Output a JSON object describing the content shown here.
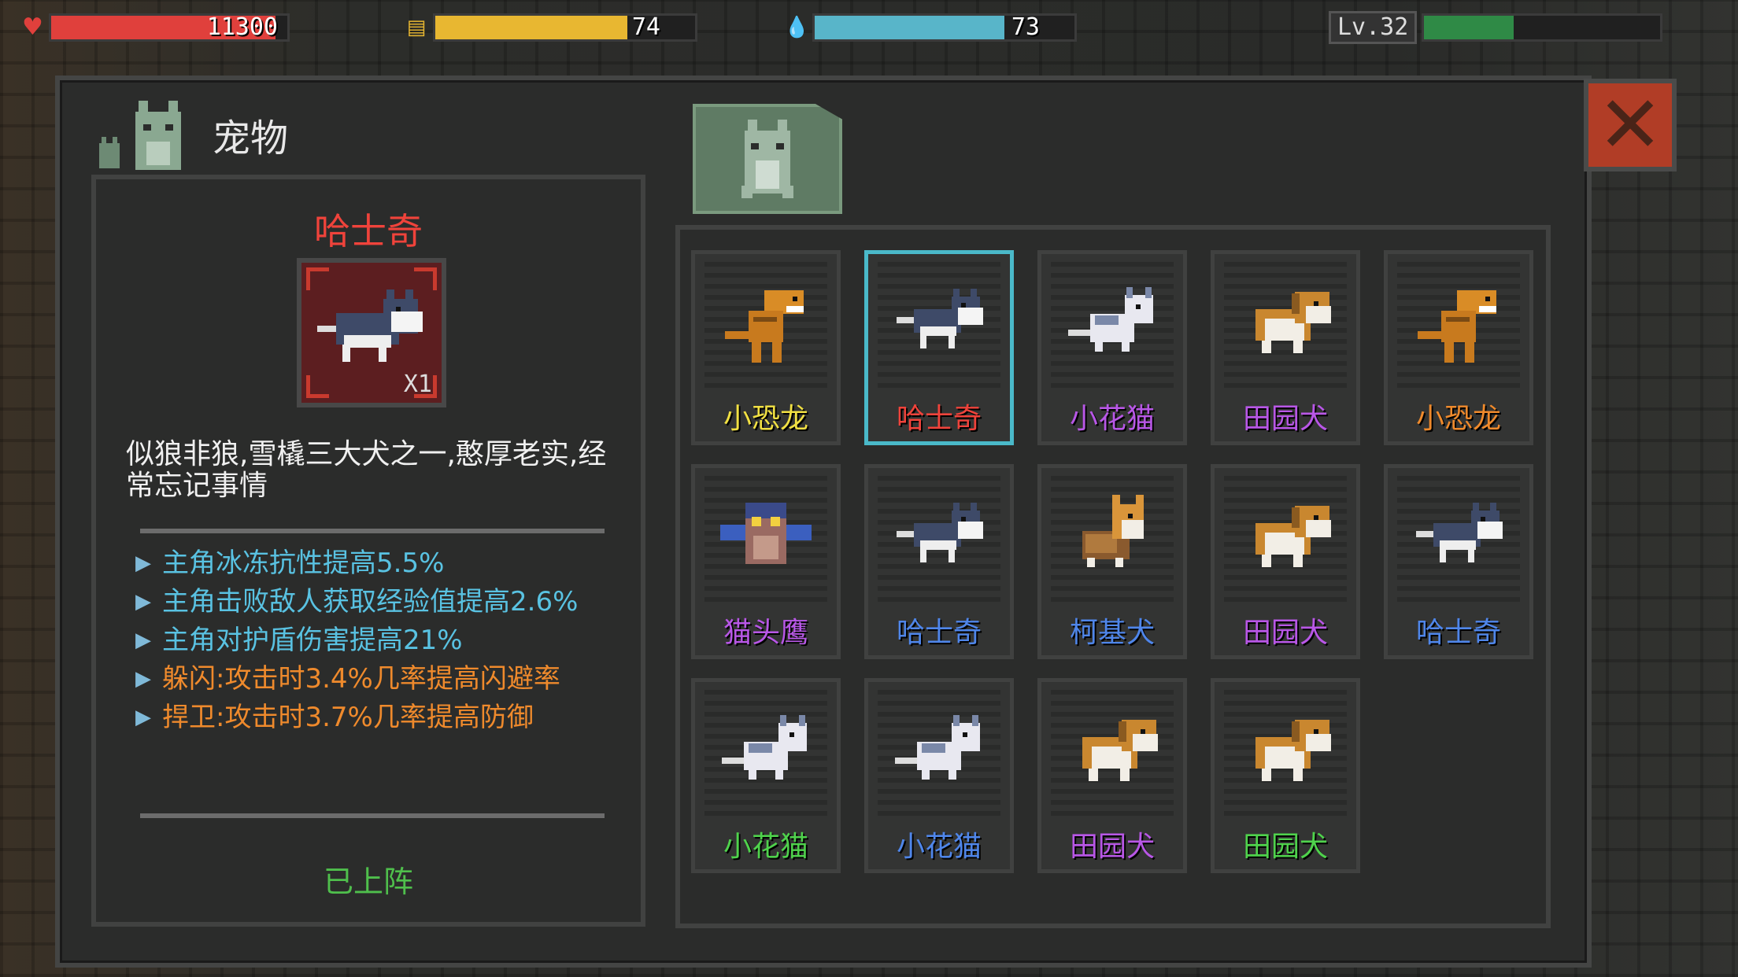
{
  "hud": {
    "health": {
      "value": "11300",
      "fill": 0.95,
      "color": "#e0403c"
    },
    "hunger": {
      "value": "74",
      "fill": 0.74,
      "color": "#e8b731"
    },
    "water": {
      "value": "73",
      "fill": 0.73,
      "color": "#58b5c9"
    },
    "level": {
      "label": "Lv.32",
      "fill": 0.38,
      "color": "#2f8a46"
    }
  },
  "panel": {
    "title": "宠物",
    "close_label": "✕"
  },
  "detail": {
    "name": "哈士奇",
    "count": "X1",
    "description": "似狼非狼,雪橇三大犬之一,憨厚老实,经常忘记事情",
    "stats": [
      {
        "text": "主角冰冻抗性提高5.5%",
        "color": "#59c2e2"
      },
      {
        "text": "主角击败敌人获取经验值提高2.6%",
        "color": "#59c2e2"
      },
      {
        "text": "主角对护盾伤害提高21%",
        "color": "#59c2e2"
      },
      {
        "text": "躲闪:攻击时3.4%几率提高闪避率",
        "color": "#ef8a2c"
      },
      {
        "text": "捍卫:攻击时3.7%几率提高防御",
        "color": "#ef8a2c"
      }
    ],
    "status": "已上阵"
  },
  "pets": [
    {
      "name": "小恐龙",
      "color": "#f1e043",
      "sprite": "dino-icon"
    },
    {
      "name": "哈士奇",
      "color": "#f0433b",
      "sprite": "husky-icon",
      "selected": true
    },
    {
      "name": "小花猫",
      "color": "#b857e6",
      "sprite": "cat-icon"
    },
    {
      "name": "田园犬",
      "color": "#b857e6",
      "sprite": "dog-icon"
    },
    {
      "name": "小恐龙",
      "color": "#ef8a2c",
      "sprite": "dino-icon"
    },
    {
      "name": "猫头鹰",
      "color": "#b857e6",
      "sprite": "owl-icon"
    },
    {
      "name": "哈士奇",
      "color": "#4f86ea",
      "sprite": "husky-icon"
    },
    {
      "name": "柯基犬",
      "color": "#4f86ea",
      "sprite": "corgi-icon"
    },
    {
      "name": "田园犬",
      "color": "#b857e6",
      "sprite": "dog-icon"
    },
    {
      "name": "哈士奇",
      "color": "#4f86ea",
      "sprite": "husky-icon"
    },
    {
      "name": "小花猫",
      "color": "#4fd24c",
      "sprite": "cat-icon"
    },
    {
      "name": "小花猫",
      "color": "#4f86ea",
      "sprite": "cat-icon"
    },
    {
      "name": "田园犬",
      "color": "#b857e6",
      "sprite": "dog-icon"
    },
    {
      "name": "田园犬",
      "color": "#4fd24c",
      "sprite": "dog-icon"
    }
  ]
}
